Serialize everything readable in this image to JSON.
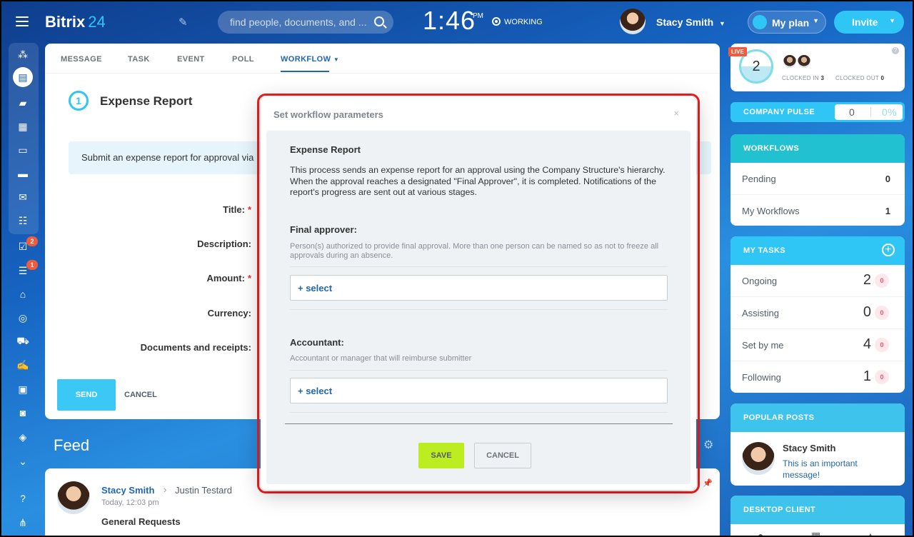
{
  "topbar": {
    "logo_name": "Bitrix",
    "logo_num": "24",
    "search_placeholder": "find people, documents, and ...",
    "time": "1:46",
    "ampm": "PM",
    "status": "WORKING",
    "user_name": "Stacy Smith",
    "plan_label": "My plan",
    "invite_label": "Invite"
  },
  "sidebar": {
    "tasks_badge": "2",
    "crm_badge": "1",
    "icons": [
      "feed-icon",
      "messenger-icon",
      "calendar-icon",
      "documents-icon",
      "drive-icon",
      "mail-icon",
      "groups-icon",
      "tasks-icon",
      "crm-icon",
      "company-icon",
      "target-icon",
      "shop-icon",
      "sign-icon",
      "contacts-icon",
      "robot-icon",
      "box-icon",
      "more-icon",
      "help-icon",
      "structure-icon"
    ]
  },
  "composer": {
    "tabs": [
      "MESSAGE",
      "TASK",
      "EVENT",
      "POLL",
      "WORKFLOW"
    ],
    "form_icon": "1",
    "form_title": "Expense Report",
    "info_text": "Submit an expense report for approval via",
    "fields": {
      "title": "Title:",
      "description": "Description:",
      "amount": "Amount:",
      "currency": "Currency:",
      "documents": "Documents and receipts:"
    },
    "required_mark": "*",
    "send": "SEND",
    "cancel": "CANCEL"
  },
  "feed": {
    "title": "Feed",
    "post": {
      "author": "Stacy Smith",
      "arrow": "›",
      "recipient": "Justin Testard",
      "time": "Today, 12:03 pm",
      "title": "General Requests"
    }
  },
  "right": {
    "live": "LIVE",
    "clocked_count": "2",
    "clocked_in_label": "CLOCKED IN",
    "clocked_in": "3",
    "clocked_out_label": "CLOCKED OUT",
    "clocked_out": "0",
    "help": "?",
    "pulse": {
      "label": "COMPANY PULSE",
      "value": "0",
      "percent": "0%"
    },
    "workflows": {
      "header": "WORKFLOWS",
      "rows": [
        {
          "label": "Pending",
          "value": "0"
        },
        {
          "label": "My Workflows",
          "value": "1"
        }
      ]
    },
    "tasks": {
      "header": "MY TASKS",
      "rows": [
        {
          "label": "Ongoing",
          "value": "2",
          "badge": "0"
        },
        {
          "label": "Assisting",
          "value": "0",
          "badge": "0"
        },
        {
          "label": "Set by me",
          "value": "4",
          "badge": "0"
        },
        {
          "label": "Following",
          "value": "1",
          "badge": "0"
        }
      ]
    },
    "popular": {
      "header": "POPULAR POSTS",
      "author": "Stacy Smith",
      "text": "This is an important message!"
    },
    "desktop": {
      "header": "DESKTOP CLIENT"
    }
  },
  "modal": {
    "title": "Set workflow parameters",
    "close": "×",
    "process_name": "Expense Report",
    "process_desc": "This process sends an expense report for an approval using the Company Structure's hierarchy. When the approval reaches a designated \"Final Approver\", it is completed. Notifications of the report's progress are sent out at various stages.",
    "final_approver": {
      "label": "Final approver:",
      "help": "Person(s) authorized to provide final approval. More than one person can be named so as not to freeze all approvals during an absence.",
      "select": "+ select"
    },
    "accountant": {
      "label": "Accountant:",
      "help": "Accountant or manager that will reimburse submitter",
      "select": "+ select"
    },
    "save": "SAVE",
    "cancel": "CANCEL"
  },
  "colors": {
    "accent": "#2fc6f6",
    "link": "#2067b0",
    "save_button": "#bbed21",
    "highlight": "#f01e1e"
  }
}
